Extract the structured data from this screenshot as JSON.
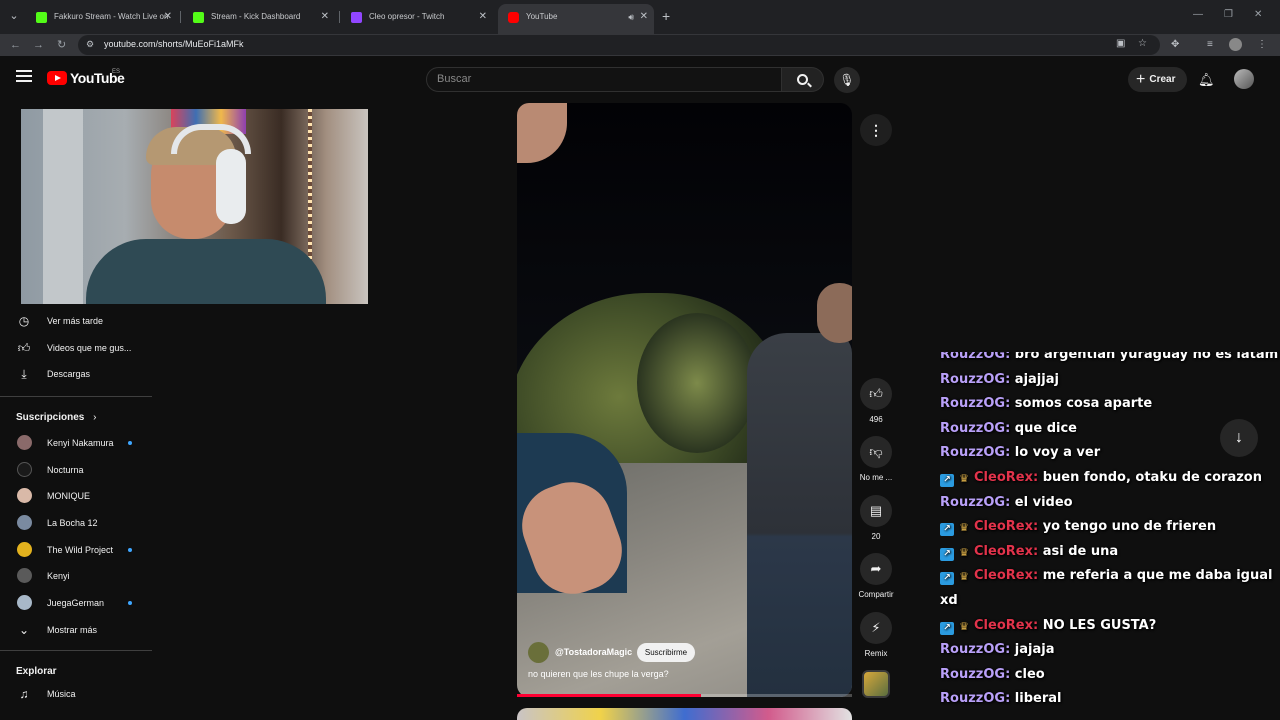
{
  "browser": {
    "tabs": [
      {
        "title": "Fakkuro Stream - Watch Live on",
        "favicon_color": "#53fc18"
      },
      {
        "title": "Stream - Kick Dashboard",
        "favicon_color": "#53fc18"
      },
      {
        "title": "Cleo opresor - Twitch",
        "favicon_color": "#9146ff"
      },
      {
        "title": "YouTube",
        "favicon_color": "#ff0000"
      }
    ],
    "url": "youtube.com/shorts/MuEoFi1aMFk"
  },
  "header": {
    "logo_text": "YouTube",
    "country": "ES",
    "search_placeholder": "Buscar",
    "create_label": "Crear"
  },
  "sidebar": {
    "items": [
      {
        "label": "Ver más tarde",
        "icon": "clock-icon"
      },
      {
        "label": "Videos que me gus...",
        "icon": "thumbs-up-icon"
      },
      {
        "label": "Descargas",
        "icon": "download-icon"
      }
    ],
    "subscriptions_heading": "Suscripciones",
    "subscriptions": [
      {
        "name": "Kenyi Nakamura",
        "live": true,
        "color": "#8a6a6a"
      },
      {
        "name": "Nocturna",
        "live": false,
        "color": "#1a1a1a"
      },
      {
        "name": "MONIQUE",
        "live": false,
        "color": "#d9b9a8"
      },
      {
        "name": "La Bocha 12",
        "live": false,
        "color": "#7a8aa0"
      },
      {
        "name": "The Wild Project",
        "live": true,
        "color": "#e3b21e"
      },
      {
        "name": "Kenyi",
        "live": false,
        "color": "#5a5a5a"
      },
      {
        "name": "JuegaGerman",
        "live": true,
        "color": "#a8b8c8"
      }
    ],
    "show_more": "Mostrar más",
    "explore_heading": "Explorar",
    "explore_items": [
      {
        "label": "Música",
        "icon": "music-note-icon"
      }
    ]
  },
  "short": {
    "channel": "@TostadoraMagic",
    "subscribe_label": "Suscribirme",
    "caption": "no quieren que les chupe la verga?",
    "progress": 0.55,
    "likes": "496",
    "dislike_label": "No me ...",
    "comments": "20",
    "share_label": "Compartir",
    "remix_label": "Remix"
  },
  "chat": [
    {
      "user": "RouzzOG",
      "text": "bro argentian yuraguay no es latam",
      "badges": false
    },
    {
      "user": "RouzzOG",
      "text": "ajajjaj",
      "badges": false
    },
    {
      "user": "RouzzOG",
      "text": "somos cosa aparte",
      "badges": false
    },
    {
      "user": "RouzzOG",
      "text": "que dice",
      "badges": false
    },
    {
      "user": "RouzzOG",
      "text": "lo voy a ver",
      "badges": false
    },
    {
      "user": "CleoRex",
      "text": "buen fondo, otaku de corazon",
      "badges": true
    },
    {
      "user": "RouzzOG",
      "text": "el video",
      "badges": false
    },
    {
      "user": "CleoRex",
      "text": "yo tengo uno de frieren",
      "badges": true
    },
    {
      "user": "CleoRex",
      "text": "asi de una",
      "badges": true
    },
    {
      "user": "CleoRex",
      "text": "me referia a que me daba igual xd",
      "badges": true
    },
    {
      "user": "CleoRex",
      "text": "NO LES GUSTA?",
      "badges": true
    },
    {
      "user": "RouzzOG",
      "text": "jajaja",
      "badges": false
    },
    {
      "user": "RouzzOG",
      "text": "cleo",
      "badges": false
    },
    {
      "user": "RouzzOG",
      "text": "liberal",
      "badges": false
    }
  ]
}
